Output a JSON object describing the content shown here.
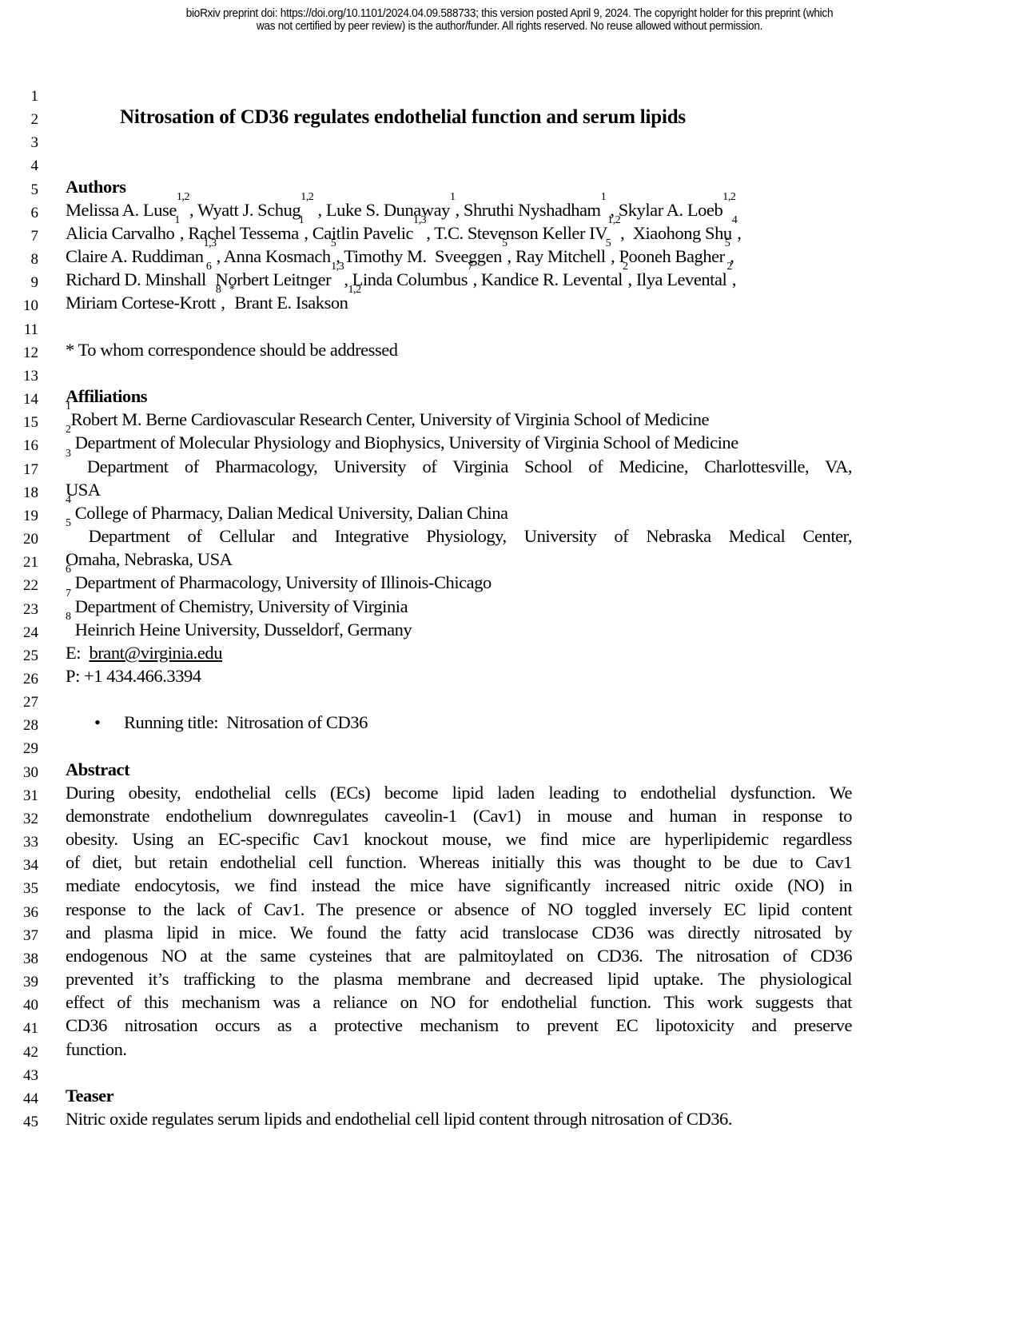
{
  "banner": {
    "line1": "bioRxiv preprint doi: https://doi.org/10.1101/2024.04.09.588733; this version posted April 9, 2024. The copyright holder for this preprint (which",
    "line2": "was not certified by peer review) is the author/funder. All rights reserved. No reuse allowed without permission."
  },
  "line_numbers": [
    "1",
    "2",
    "3",
    "4",
    "5",
    "6",
    "7",
    "8",
    "9",
    "10",
    "11",
    "12",
    "13",
    "14",
    "15",
    "16",
    "17",
    "18",
    "19",
    "20",
    "21",
    "22",
    "23",
    "24",
    "25",
    "26",
    "27",
    "28",
    "29",
    "30",
    "31",
    "32",
    "33",
    "34",
    "35",
    "36",
    "37",
    "38",
    "39",
    "40",
    "41",
    "42",
    "43",
    "44",
    "45"
  ],
  "title": "Nitrosation of CD36 regulates endothelial function and serum lipids",
  "authors": {
    "heading": "Authors",
    "lines": [
      [
        {
          "t": "Melissa A. Luse",
          "s": "1,2"
        },
        {
          "t": ", Wyatt J. Schug",
          "s": "1,2"
        },
        {
          "t": " , Luke S. Dunaway",
          "s": "1"
        },
        {
          "t": ", Shruthi Nyshadham",
          "s": "1"
        },
        {
          "t": " , Skylar A. Loeb",
          "s": "1,2"
        }
      ],
      [
        {
          "t": "Alicia Carvalho",
          "s": "1"
        },
        {
          "t": ", Rachel Tessema",
          "s": "1"
        },
        {
          "t": ", Caitlin Pavelic",
          "s": "1,3"
        },
        {
          "t": ", T.C. Stevenson Keller IV",
          "s": "1,2"
        },
        {
          "t": ",  Xiaohong Shu",
          "s": "4"
        },
        {
          "t": ",",
          "s": ""
        }
      ],
      [
        {
          "t": "Claire A. Ruddiman",
          "s": "1,3"
        },
        {
          "t": ", Anna Kosmach",
          "s": "5"
        },
        {
          "t": ", Timothy M.  Sveeggen",
          "s": "5"
        },
        {
          "t": ", Ray Mitchell",
          "s": "5"
        },
        {
          "t": ", Pooneh Bagher",
          "s": "5"
        },
        {
          "t": ",",
          "s": ""
        }
      ],
      [
        {
          "t": "Richard D. Minshall",
          "s": "6"
        },
        {
          "t": " Norbert Leitnger",
          "s": "1,3"
        },
        {
          "t": ", Linda Columbus",
          "s": "7"
        },
        {
          "t": ", Kandice R. Levental",
          "s": "2"
        },
        {
          "t": ", Ilya Levental",
          "s": "2"
        },
        {
          "t": ",",
          "s": ""
        }
      ],
      [
        {
          "t": "Miriam Cortese-Krott",
          "s": "8"
        },
        {
          "t": ", ",
          "s": "*"
        },
        {
          "t": "Brant E. Isakson",
          "s": "1,2"
        }
      ]
    ],
    "correspondence_note": "* To whom correspondence should be addressed"
  },
  "affiliations": {
    "heading": "Affiliations",
    "items": [
      {
        "sup": "1",
        "text": "Robert M. Berne Cardiovascular Research Center, University of Virginia School of Medicine"
      },
      {
        "sup": "2",
        "text": " Department of Molecular Physiology and Biophysics, University of Virginia School of Medicine"
      },
      {
        "sup": "3",
        "text": " Department of Pharmacology, University of Virginia School of Medicine, Charlottesville, VA,"
      },
      {
        "sup": "",
        "text": "USA"
      },
      {
        "sup": "4",
        "text": " College of Pharmacy, Dalian Medical University, Dalian China"
      },
      {
        "sup": "5",
        "text": " Department of Cellular and Integrative Physiology, University of Nebraska Medical Center,"
      },
      {
        "sup": "",
        "text": "Omaha, Nebraska, USA"
      },
      {
        "sup": "6",
        "text": " Department of Pharmacology, University of Illinois-Chicago"
      },
      {
        "sup": "7",
        "text": " Department of Chemistry, University of Virginia"
      },
      {
        "sup": "8",
        "text": " Heinrich Heine University, Dusseldorf, Germany"
      }
    ],
    "email_label": "E:  ",
    "email": "brant@virginia.edu",
    "phone": "P: +1 434.466.3394"
  },
  "running_title": {
    "bullet": "•",
    "text": "Running title:  Nitrosation of CD36"
  },
  "abstract": {
    "heading": "Abstract",
    "lines": [
      "During obesity, endothelial cells (ECs) become lipid laden leading to endothelial dysfunction. We",
      "demonstrate endothelium downregulates caveolin-1 (Cav1) in mouse and human in response to",
      "obesity. Using an EC-specific Cav1 knockout mouse, we find mice are hyperlipidemic regardless",
      "of diet, but retain endothelial cell function. Whereas initially this was thought to be due to Cav1",
      "mediate endocytosis, we find instead the mice have significantly increased nitric oxide (NO) in",
      "response to the lack of Cav1. The presence or absence of NO toggled inversely EC lipid content",
      "and plasma lipid in mice. We found the fatty acid translocase CD36 was directly nitrosated by",
      "endogenous NO at the same cysteines that are palmitoylated on CD36. The nitrosation of CD36",
      "prevented it’s trafficking to the plasma membrane and decreased lipid uptake. The physiological",
      "effect of this mechanism was a reliance on NO for endothelial function. This work suggests that",
      "CD36 nitrosation occurs as a protective mechanism to prevent EC lipotoxicity and preserve",
      "function."
    ]
  },
  "teaser": {
    "heading": "Teaser",
    "text": "Nitric oxide regulates serum lipids and endothelial cell lipid content through nitrosation of CD36."
  }
}
